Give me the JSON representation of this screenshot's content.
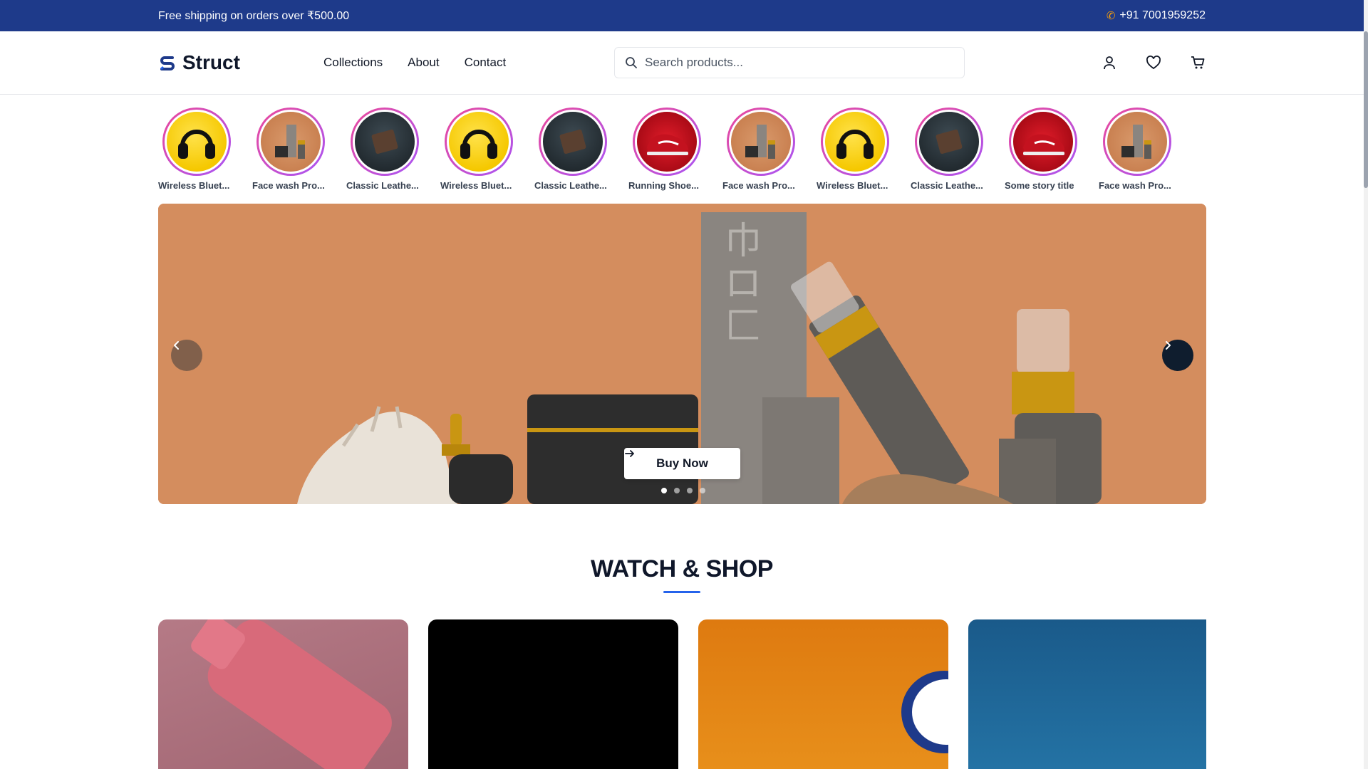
{
  "topbar": {
    "promo": "Free shipping on orders over ₹500.00",
    "phone": "+91 7001959252"
  },
  "header": {
    "brand": "Struct",
    "nav": [
      "Collections",
      "About",
      "Contact"
    ],
    "search_placeholder": "Search products..."
  },
  "stories": [
    {
      "label": "Wireless Bluet...",
      "thumb": "headphones"
    },
    {
      "label": "Face wash Pro...",
      "thumb": "cosmetics"
    },
    {
      "label": "Classic Leathe...",
      "thumb": "wallet"
    },
    {
      "label": "Wireless Bluet...",
      "thumb": "headphones"
    },
    {
      "label": "Classic Leathe...",
      "thumb": "wallet"
    },
    {
      "label": "Running Shoe...",
      "thumb": "shoe"
    },
    {
      "label": "Face wash Pro...",
      "thumb": "cosmetics"
    },
    {
      "label": "Wireless Bluet...",
      "thumb": "headphones"
    },
    {
      "label": "Classic Leathe...",
      "thumb": "wallet"
    },
    {
      "label": "Some story title",
      "thumb": "shoe"
    },
    {
      "label": "Face wash Pro...",
      "thumb": "cosmetics"
    }
  ],
  "hero": {
    "cta": "Buy Now",
    "slides": 4,
    "active_slide": 1
  },
  "watch_shop": {
    "title": "WATCH & SHOP"
  },
  "colors": {
    "topbar": "#1e3a8a",
    "accent": "#2563eb",
    "story_ring": "#ec4899"
  }
}
